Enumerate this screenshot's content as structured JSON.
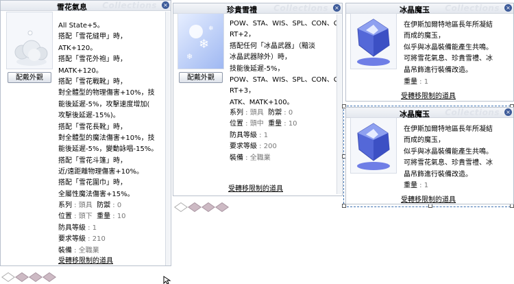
{
  "watermark": "Collections",
  "close_glyph": "×",
  "win1": {
    "title": "雪花氣息",
    "button": "配戴外觀",
    "lines": [
      "All State+5。",
      "搭配「雪花縫甲」時，",
      "ATK+120。",
      "搭配「雪花外袍」時，",
      "MATK+120。",
      "搭配「雪花戰靴」時，",
      "對全體型的物理傷害+10%，技",
      "能後延遲-5%，攻擊速度增加(",
      "攻擊後延遲-15%)。",
      "搭配「雪花長靴」時，",
      "對全體型的魔法傷害+10%，技",
      "能後延遲-5%，變動詠唱-15%。",
      "搭配「雪花斗篷」時，",
      "近/遠距離物理傷害+10%。",
      "搭配「雪花圍巾」時，",
      "全屬性魔法傷害+15%。"
    ],
    "stats": [
      {
        "label": "系列",
        "value": "頭具",
        "label2": "防禦",
        "value2": "0"
      },
      {
        "label": "位置",
        "value": "頭下",
        "label2": "重量",
        "value2": "10"
      },
      {
        "label": "防具等級",
        "value": "1"
      },
      {
        "label": "要求等級",
        "value": "210"
      },
      {
        "label": "裝備",
        "value": "全職業"
      }
    ],
    "link": "受轉移限制的道具"
  },
  "win2": {
    "title": "珍貴雪禮",
    "button": "配戴外觀",
    "lines": [
      "POW、STA、WIS、SPL、CON、C",
      "RT+2，",
      "搭配任何「冰晶武器」（黯淡",
      "冰晶武器除外）時，",
      "技能後延遲-5%，",
      "POW、STA、WIS、SPL、CON、C",
      "RT+3，",
      "ATK、MATK+100。"
    ],
    "stats": [
      {
        "label": "系列",
        "value": "頭具",
        "label2": "防禦",
        "value2": "0"
      },
      {
        "label": "位置",
        "value": "頭中",
        "label2": "重量",
        "value2": "10"
      },
      {
        "label": "防具等級",
        "value": "1"
      },
      {
        "label": "要求等級",
        "value": "200"
      },
      {
        "label": "裝備",
        "value": "全職業"
      }
    ],
    "link": "受轉移限制的道具"
  },
  "win3": {
    "title": "冰晶魔玉",
    "lines": [
      "在伊斯加爾特地區長年所凝結",
      "而成的魔玉，",
      "似乎與冰晶裝備能產生共鳴。",
      "可將雪花氣息、珍貴雪禮、冰",
      "晶吊飾進行裝備改造。"
    ],
    "stats": [
      {
        "label": "重量",
        "value": "1"
      }
    ],
    "link": "受轉移限制的道具"
  },
  "win4": {
    "title": "冰晶魔玉",
    "lines": [
      "在伊斯加爾特地區長年所凝結",
      "而成的魔玉，",
      "似乎與冰晶裝備能產生共鳴。",
      "可將雪花氣息、珍貴雪禮、冰",
      "晶吊飾進行裝備改造。"
    ],
    "stats": [
      {
        "label": "重量",
        "value": "1"
      }
    ],
    "link": "受轉移限制的道具"
  },
  "colors": {
    "accent": "#3e5c9a",
    "value_gray": "#777777",
    "selection": "#3a6fb0"
  }
}
